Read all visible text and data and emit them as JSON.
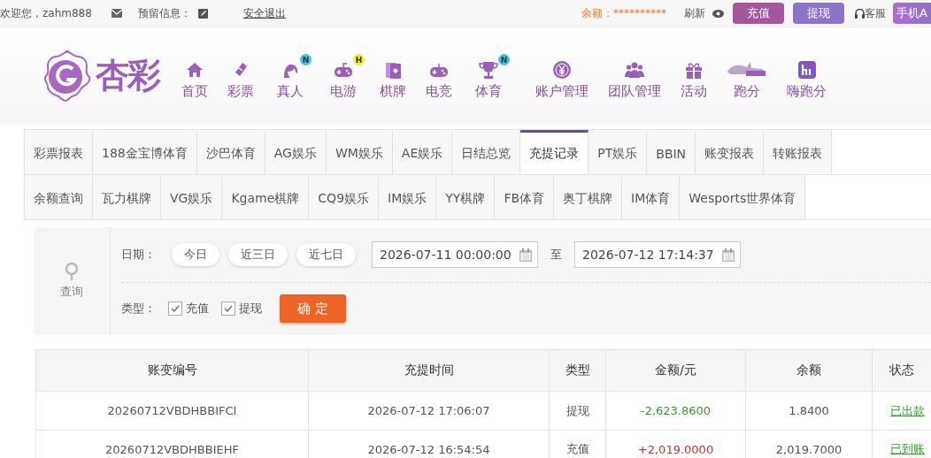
{
  "top_bar": {
    "welcome": "欢迎您，zahm888",
    "reserved_info_label": "预留信息：",
    "logout_link": "安全退出",
    "balance_label": "余额：",
    "balance_value": "**********",
    "refresh": "刷新",
    "buttons": [
      {
        "label": "充值",
        "kind": "deposit"
      },
      {
        "label": "提现",
        "kind": "withdraw"
      }
    ],
    "support": "客服",
    "mobile_button": "手机A"
  },
  "logo": {
    "text": "杏彩"
  },
  "nav": [
    {
      "label": "首页"
    },
    {
      "label": "彩票"
    },
    {
      "label": "真人",
      "badge": "N",
      "color": "#3fc6ea"
    },
    {
      "label": "电游",
      "badge": "H",
      "color": "#f3ec3c"
    },
    {
      "label": "棋牌"
    },
    {
      "label": "电竞"
    },
    {
      "label": "体育",
      "badge": "N",
      "color": "#3fc6ea"
    },
    {
      "label": "账户管理"
    },
    {
      "label": "团队管理"
    },
    {
      "label": "活动"
    },
    {
      "label": "跑分"
    },
    {
      "label": "嗨跑分"
    }
  ],
  "tab_rows": [
    [
      {
        "label": "彩票报表",
        "selected": false
      },
      {
        "label": "188金宝博体育",
        "selected": false
      },
      {
        "label": "沙巴体育",
        "selected": false
      },
      {
        "label": "AG娱乐",
        "selected": false
      },
      {
        "label": "WM娱乐",
        "selected": false
      },
      {
        "label": "AE娱乐",
        "selected": false
      },
      {
        "label": "日结总览",
        "selected": false
      },
      {
        "label": "充提记录",
        "selected": true
      },
      {
        "label": "PT娱乐",
        "selected": false
      },
      {
        "label": "BBIN",
        "selected": false
      },
      {
        "label": "账变报表",
        "selected": false
      },
      {
        "label": "转账报表",
        "selected": false
      }
    ],
    [
      {
        "label": "余额查询",
        "selected": false
      },
      {
        "label": "瓦力棋牌",
        "selected": false
      },
      {
        "label": "VG娱乐",
        "selected": false
      },
      {
        "label": "Kgame棋牌",
        "selected": false
      },
      {
        "label": "CQ9娱乐",
        "selected": false
      },
      {
        "label": "IM娱乐",
        "selected": false
      },
      {
        "label": "YY棋牌",
        "selected": false
      },
      {
        "label": "FB体育",
        "selected": false
      },
      {
        "label": "奥丁棋牌",
        "selected": false
      },
      {
        "label": "IM体育",
        "selected": false
      },
      {
        "label": "Wesports世界体育",
        "selected": false
      }
    ]
  ],
  "filter": {
    "side_label": "查询",
    "date_label": "日期：",
    "quick_ranges": [
      "今日",
      "近三日",
      "近七日"
    ],
    "start": "2026-07-11 00:00:00",
    "to_label": "至",
    "end": "2026-07-12 17:14:37",
    "type_label": "类型：",
    "types": [
      {
        "label": "充值",
        "checked": true
      },
      {
        "label": "提现",
        "checked": true
      }
    ],
    "submit": "确 定"
  },
  "table": {
    "columns": [
      "账变编号",
      "充提时间",
      "类型",
      "金额/元",
      "余额",
      "状态"
    ],
    "rows": [
      {
        "id": "20260712VBDHBBIFCI",
        "time": "2026-07-12 17:06:07",
        "type": "提现",
        "amount": "-2,623.8600",
        "kind": "debit",
        "balance": "1.8400",
        "status": "已出款"
      },
      {
        "id": "20260712VBDHBBIEHF",
        "time": "2026-07-12 16:54:54",
        "type": "充值",
        "amount": "+2,019.0000",
        "kind": "credit",
        "balance": "2,019.7000",
        "status": "已到账"
      }
    ]
  }
}
